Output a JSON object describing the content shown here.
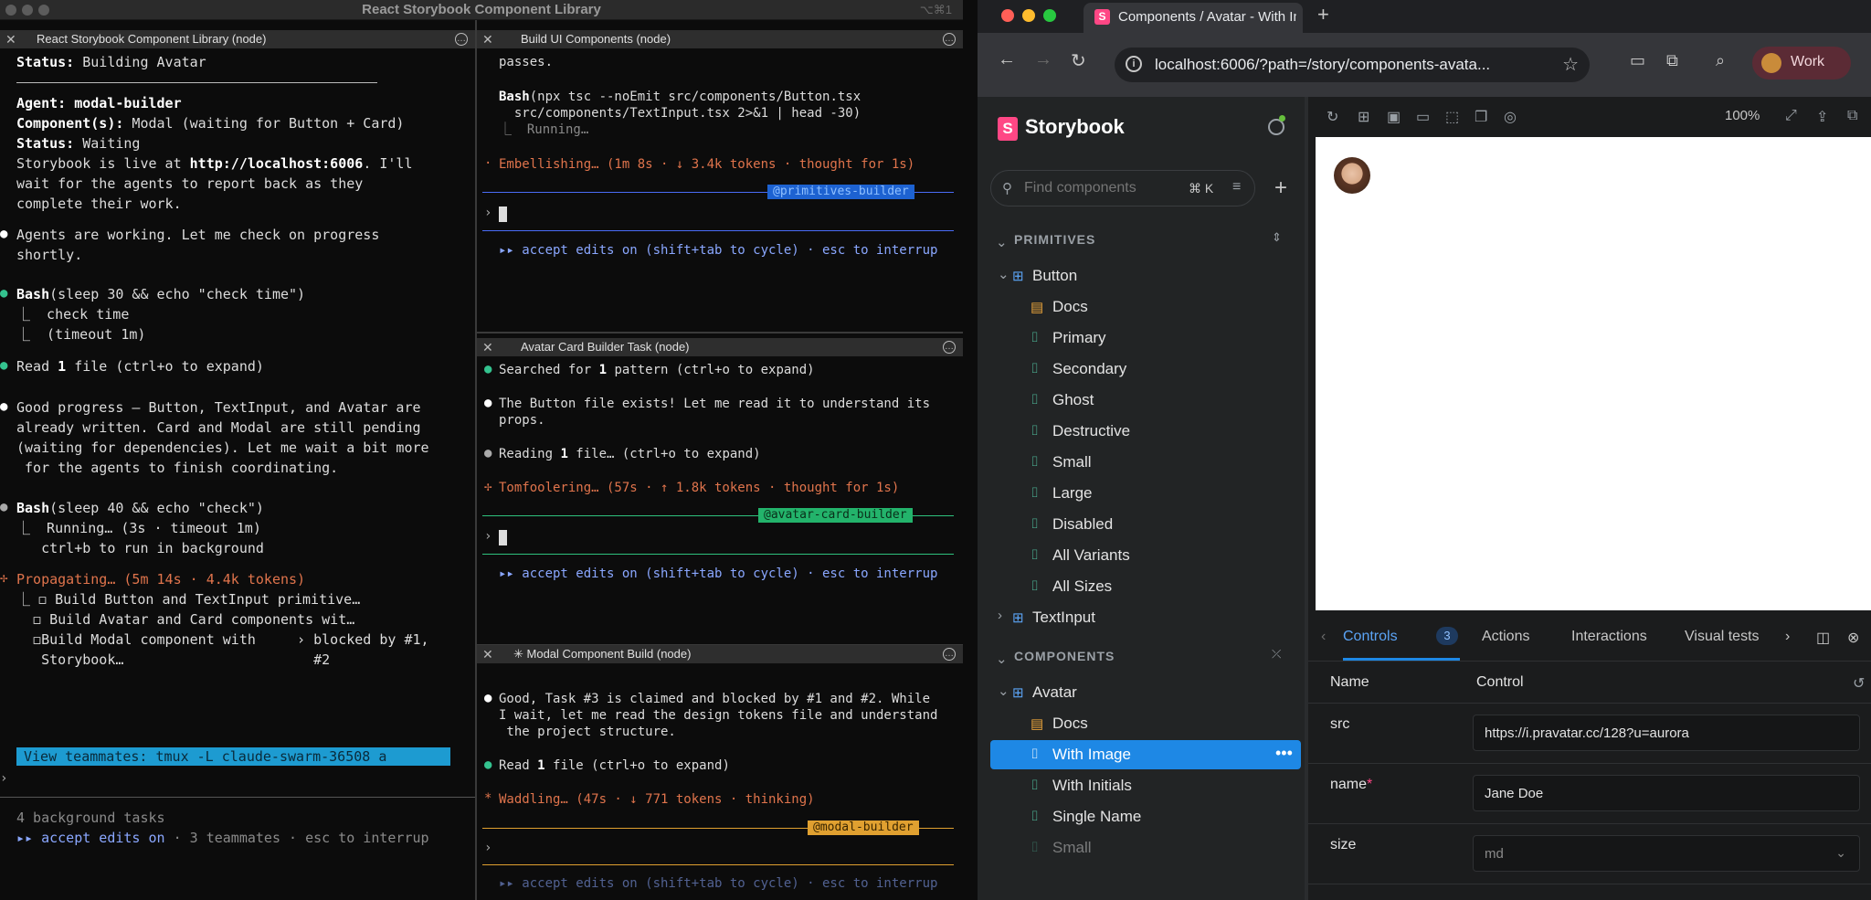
{
  "terminal": {
    "title": "React Storybook Component Library",
    "right": "⌥⌘1",
    "left_pane": {
      "title": "React Storybook Component Library (node)",
      "lines": {
        "status_build_k": "Status:",
        "status_build_v": " Building Avatar",
        "agent_k": "Agent:",
        "agent_v": " modal-builder",
        "comp_k": "Component(s):",
        "comp_v": " Modal (waiting for Button + Card)",
        "status_wait_k": "Status:",
        "status_wait_v": " Waiting",
        "live_a": "Storybook is live at ",
        "live_url": "http://localhost:6006",
        "live_b": ". I'll",
        "live_2": "wait for the agents to report back as they",
        "live_3": "complete their work.",
        "agents_1": "Agents are working. Let me check on progress",
        "agents_2": "shortly.",
        "bash1_k": "Bash",
        "bash1_v": "(sleep 30 && echo \"check time\")",
        "bash1_a": "⎿  check time",
        "bash1_b": "⎿  (timeout 1m)",
        "read_a": "Read ",
        "read_n": "1",
        "read_b": " file (ctrl+o to expand)",
        "good_1": "Good progress — Button, TextInput, and Avatar are",
        "good_2": "already written. Card and Modal are still pending",
        "good_3": "(waiting for dependencies). Let me wait a bit more",
        "good_4": " for the agents to finish coordinating.",
        "bash2_k": "Bash",
        "bash2_v": "(sleep 40 && echo \"check\")",
        "bash2_a": "⎿  Running… (3s · timeout 1m)",
        "bash2_b": "   ctrl+b to run in background",
        "prop": "Propagating… (5m 14s · 4.4k tokens)",
        "task1": "⎿ ◻ Build Button and TextInput primitive…",
        "task2": "  ◻ Build Avatar and Card components wit…",
        "task3": "  ◻Build Modal component with     › blocked by #1,",
        "task4": "   Storybook…                       #2",
        "teammates": "View teammates: tmux -L claude-swarm-36508 a",
        "bg": "4 background tasks",
        "accept_a": "▸▸ accept edits on",
        "accept_b": " · 3 teammates · esc to interrup"
      }
    },
    "pane_build": {
      "title": "Build UI Components (node)",
      "passes": "passes.",
      "bash_k": "Bash",
      "bash_v": "(npx tsc --noEmit src/components/Button.tsx",
      "bash_v2": "  src/components/TextInput.tsx 2>&1 | head -30)",
      "running": "⎿  Running…",
      "embel": "Embellishing… (1m 8s · ↓ 3.4k tokens · thought for 1s)",
      "tag": "@primitives-builder",
      "accept": "▸▸ accept edits on (shift+tab to cycle) · esc to interrup"
    },
    "pane_avatar": {
      "title": "Avatar Card Builder Task (node)",
      "l1a": "Searched for ",
      "l1n": "1",
      "l1b": " pattern (ctrl+o to expand)",
      "l2": "The Button file exists! Let me read it to understand its",
      "l3": "props.",
      "l4a": "Reading ",
      "l4n": "1",
      "l4b": " file… (ctrl+o to expand)",
      "l5": "Tomfoolering… (57s · ↑ 1.8k tokens · thought for 1s)",
      "tag": "@avatar-card-builder",
      "accept": "▸▸ accept edits on (shift+tab to cycle) · esc to interrup"
    },
    "pane_modal": {
      "title": "✳ Modal Component Build (node)",
      "l1": "Good, Task #3 is claimed and blocked by #1 and #2. While",
      "l2": "I wait, let me read the design tokens file and understand",
      "l3": " the project structure.",
      "l4a": "Read ",
      "l4n": "1",
      "l4b": " file (ctrl+o to expand)",
      "l5": "Waddling… (47s · ↓ 771 tokens · thinking)",
      "tag": "@modal-builder",
      "accept": "▸▸ accept edits on (shift+tab to cycle) · esc to interrup"
    }
  },
  "browser": {
    "tab_title": "Components / Avatar - With Image",
    "url": "localhost:6006/?path=/story/components-avata...",
    "profile": "Work",
    "zoom": "100%"
  },
  "storybook": {
    "brand": "Storybook",
    "search_placeholder": "Find components",
    "search_kbd": "⌘ K",
    "section_primitives": "PRIMITIVES",
    "section_components": "COMPONENTS",
    "button": "Button",
    "button_stories": [
      "Docs",
      "Primary",
      "Secondary",
      "Ghost",
      "Destructive",
      "Small",
      "Large",
      "Disabled",
      "All Variants",
      "All Sizes"
    ],
    "textinput": "TextInput",
    "avatar": "Avatar",
    "avatar_stories": [
      "Docs",
      "With Image",
      "With Initials",
      "Single Name",
      "Small"
    ]
  },
  "addons": {
    "tabs": [
      "Controls",
      "Actions",
      "Interactions",
      "Visual tests"
    ],
    "controls_count": "3",
    "col_name": "Name",
    "col_control": "Control",
    "rows": [
      {
        "name": "src",
        "value": "https://i.pravatar.cc/128?u=aurora"
      },
      {
        "name": "name",
        "value": "Jane Doe"
      },
      {
        "name": "size",
        "value": "md"
      }
    ]
  }
}
